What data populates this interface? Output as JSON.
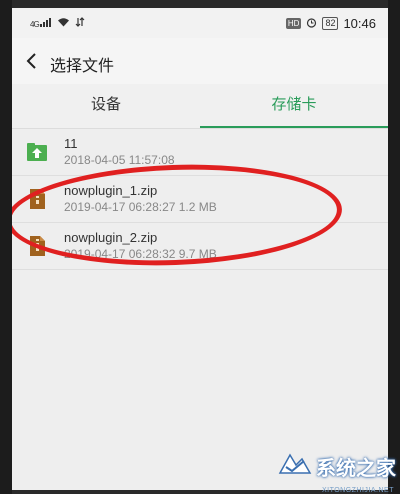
{
  "status_bar": {
    "signal_label": "4G",
    "hd_label": "HD",
    "battery": "82",
    "time": "10:46"
  },
  "app_bar": {
    "title": "选择文件"
  },
  "tabs": [
    {
      "label": "设备",
      "active": false
    },
    {
      "label": "存储卡",
      "active": true
    }
  ],
  "files": [
    {
      "name": "11",
      "meta": "2018-04-05 11:57:08",
      "icon": "folder-up-icon"
    },
    {
      "name": "nowplugin_1.zip",
      "meta": "2019-04-17 06:28:27  1.2 MB",
      "icon": "zip-file-icon"
    },
    {
      "name": "nowplugin_2.zip",
      "meta": "2019-04-17 06:28:32  9.7 MB",
      "icon": "zip-file-icon"
    }
  ],
  "watermark": {
    "text": "系统之家",
    "url": "XITONGZHIJIA.NET"
  },
  "colors": {
    "accent": "#2a9c5a",
    "annotation": "#e02020"
  }
}
